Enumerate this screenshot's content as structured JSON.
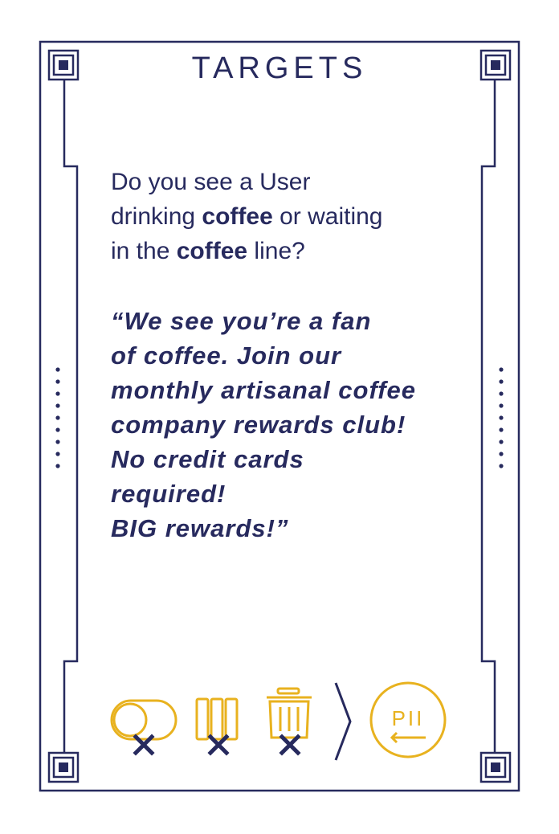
{
  "card": {
    "title": "TARGETS",
    "prompt": {
      "line1": "Do you see a User",
      "line2_pre": "drinking ",
      "line2_bold": "coffee",
      "line2_post": " or waiting",
      "line3_pre": "in the ",
      "line3_bold": "coffee",
      "line3_post": " line?"
    },
    "quote_lines": [
      "“We see you’re a fan",
      "of coffee. Join our",
      "monthly artisanal coffee",
      "company rewards club!",
      "No credit cards",
      "required!",
      "BIG rewards!”"
    ],
    "footer": {
      "icons": [
        "toggle-off-icon",
        "columns-blocked-icon",
        "trash-blocked-icon",
        "chevron-right-icon",
        "pii-return-icon"
      ],
      "pii_label": "PII"
    }
  },
  "colors": {
    "navy": "#272a5e",
    "gold": "#e8b21f",
    "white": "#ffffff"
  }
}
